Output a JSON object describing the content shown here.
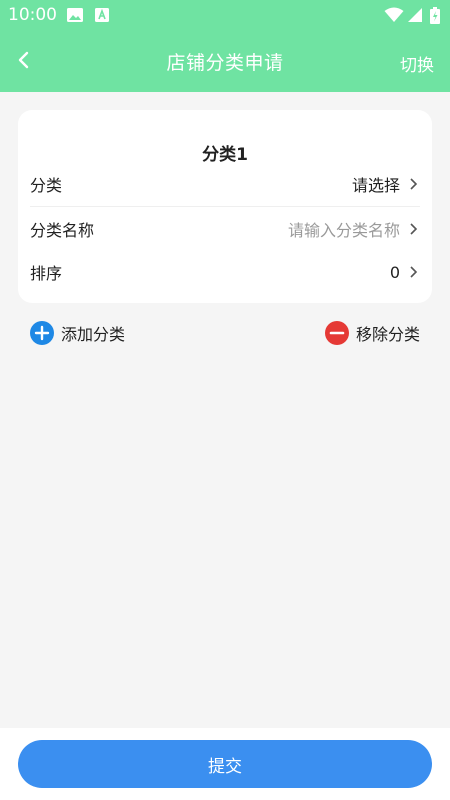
{
  "statusbar": {
    "time": "10:00",
    "icons": [
      "image-icon",
      "text-a-icon",
      "wifi-icon",
      "signal-icon",
      "battery-icon"
    ]
  },
  "header": {
    "title": "店铺分类申请",
    "switch_label": "切换",
    "back_icon": "chevron-left-icon"
  },
  "card": {
    "title": "分类1",
    "rows": [
      {
        "label": "分类",
        "value": "请选择"
      },
      {
        "label": "分类名称",
        "value": "请输入分类名称"
      },
      {
        "label": "排序",
        "value": "0"
      }
    ]
  },
  "actions": {
    "add_label": "添加分类",
    "remove_label": "移除分类"
  },
  "submit": {
    "label": "提交"
  },
  "colors": {
    "header": "#6fe3a2",
    "primary": "#3b8ff0",
    "add_icon": "#1e88e5",
    "remove_icon": "#e53935",
    "placeholder": "#9a9a9a"
  }
}
